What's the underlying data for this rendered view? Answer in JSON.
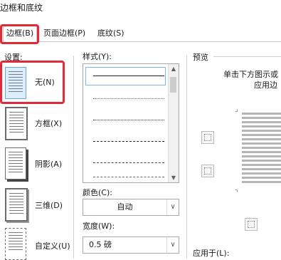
{
  "window": {
    "title": "边框和底纹"
  },
  "tabs": [
    {
      "label": "边框(B)",
      "active": true
    },
    {
      "label": "页面边框(P)"
    },
    {
      "label": "底纹(S)"
    }
  ],
  "settings": {
    "label": "设置:",
    "items": [
      {
        "label": "无(N)",
        "selected": true
      },
      {
        "label": "方框(X)"
      },
      {
        "label": "阴影(A)"
      },
      {
        "label": "三维(D)"
      },
      {
        "label": "自定义(U)"
      }
    ]
  },
  "style": {
    "label": "样式(Y):",
    "line_styles": [
      "solid",
      "dotted-fine",
      "dotted",
      "dashed",
      "dash-dot",
      "dash-dot-dot"
    ]
  },
  "color": {
    "label": "颜色(C):",
    "value": "自动"
  },
  "width": {
    "label": "宽度(W):",
    "value": "0.5 磅"
  },
  "preview": {
    "label": "预览",
    "hint_line1": "单击下方图示或",
    "hint_line2": "应用边",
    "apply_label": "应用于(L):"
  },
  "colors": {
    "highlight": "#e02a3a",
    "selected_bg": "#dbeeff"
  }
}
